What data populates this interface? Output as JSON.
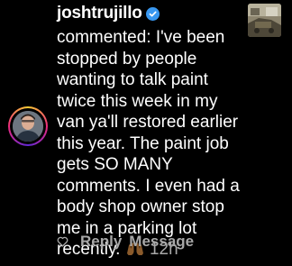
{
  "comment": {
    "username": "joshtrujillo",
    "verified_icon": "verified-badge-icon",
    "prefix": "commented:",
    "text": "I've been stopped by people wanting to talk paint twice this week in my van ya'll restored earlier this year. The paint job gets SO MANY comments. I even had a body shop owner stop me in a parking lot recently.",
    "emoji_icon": "raised-hands-icon",
    "time": "12h"
  },
  "actions": {
    "like_icon": "heart-icon",
    "reply_label": "Reply",
    "message_label": "Message"
  },
  "colors": {
    "background": "#000000",
    "text": "#ffffff",
    "muted": "#a8a8a8",
    "verified": "#3897f0"
  }
}
